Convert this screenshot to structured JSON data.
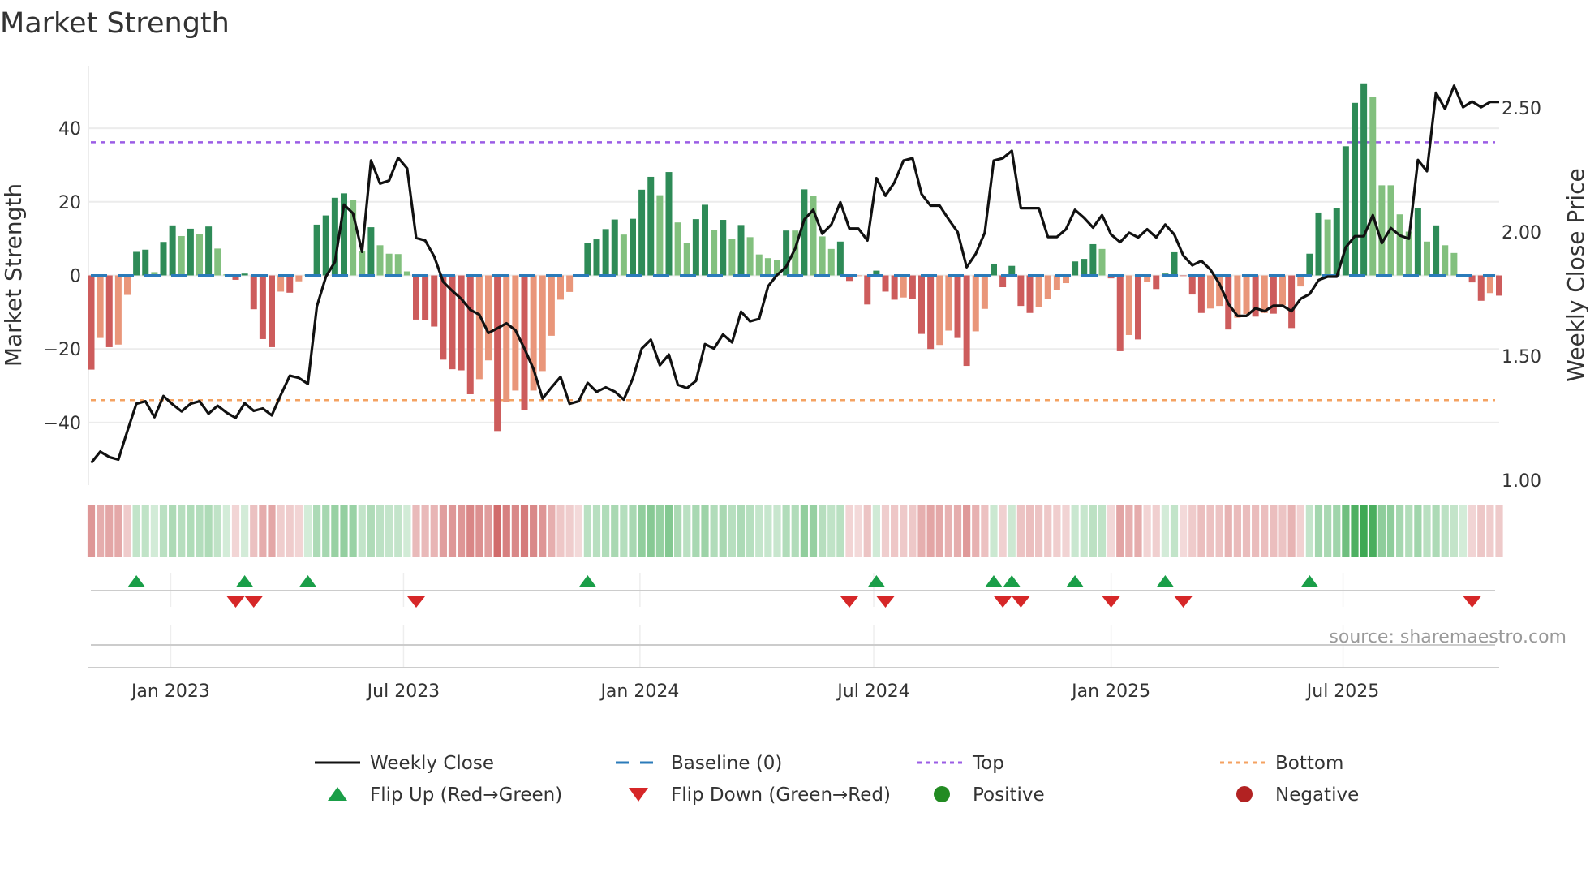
{
  "chart_data": {
    "type": "bar",
    "title": "Market Strength",
    "ylabel": "Market Strength",
    "y2label": "Weekly Close Price",
    "ylim": [
      -57,
      57
    ],
    "y2lim": [
      0.98,
      2.67
    ],
    "yticks": [
      -40,
      -20,
      0,
      20,
      40
    ],
    "yticklabels": [
      "−40",
      "−20",
      "0",
      "20",
      "40"
    ],
    "y2ticks": [
      1.0,
      1.5,
      2.0,
      2.5
    ],
    "y2ticklabels": [
      "1.00",
      "1.50",
      "2.00",
      "2.50"
    ],
    "x_unit": "week index",
    "xticks": [
      {
        "label": "Jan 2023",
        "week": 8.8
      },
      {
        "label": "Jul 2023",
        "week": 34.6
      },
      {
        "label": "Jan 2024",
        "week": 60.8
      },
      {
        "label": "Jul 2024",
        "week": 86.7
      },
      {
        "label": "Jan 2025",
        "week": 113.0
      },
      {
        "label": "Jul 2025",
        "week": 138.7
      }
    ],
    "grid": true,
    "reference_lines": {
      "baseline": 0,
      "top": 36.2,
      "bottom": -33.9
    },
    "series": [
      {
        "name": "Market Strength",
        "type": "bar",
        "values": [
          -25.6,
          -17,
          -19.5,
          -18.8,
          -5.3,
          6.4,
          7,
          0.9,
          9.1,
          13.6,
          10.7,
          12.7,
          11.3,
          13.3,
          7.3,
          0.3,
          -1.2,
          0.5,
          -9.2,
          -17.3,
          -19.5,
          -4.4,
          -4.7,
          -1.6,
          0.2,
          13.8,
          16.3,
          21.1,
          22.3,
          20.6,
          6.5,
          13.1,
          8.2,
          5.9,
          5.8,
          1.1,
          -12,
          -12.2,
          -13.9,
          -22.9,
          -25.5,
          -25.8,
          -32.3,
          -28.2,
          -23.1,
          -42.3,
          -34.4,
          -31.3,
          -36.6,
          -31.3,
          -26,
          -16.4,
          -6.6,
          -4.5,
          -0.1,
          8.9,
          9.8,
          12.6,
          15.2,
          11.1,
          15.4,
          23.3,
          26.8,
          21.8,
          28.1,
          14.4,
          8.9,
          15.3,
          19.2,
          12.3,
          15.1,
          10,
          13.7,
          10.4,
          5.7,
          4.7,
          4.3,
          12.2,
          12.2,
          23.4,
          21.6,
          10.6,
          7.2,
          9.2,
          -1.5,
          -0.1,
          -7.9,
          1.3,
          -4.4,
          -6.6,
          -6,
          -6.4,
          -15.9,
          -20,
          -18.9,
          -15,
          -17,
          -24.6,
          -15.2,
          -9.1,
          3.2,
          -3.2,
          2.6,
          -8.3,
          -10.2,
          -8.6,
          -6.4,
          -3.9,
          -2.1,
          3.8,
          4.5,
          8.5,
          7.2,
          -0.8,
          -20.6,
          -16.2,
          -17.4,
          -1.7,
          -3.7,
          0.5,
          6.3,
          -0.1,
          -5.2,
          -10.2,
          -9,
          -8.3,
          -14.7,
          -11.5,
          -10.5,
          -11.2,
          -10.2,
          -10.4,
          -8.1,
          -14.3,
          -3,
          5.9,
          17.1,
          15.2,
          18.2,
          35.1,
          46.9,
          52.2,
          48.6,
          24.5,
          24.5,
          16.6,
          11.9,
          18.2,
          9.2,
          13.6,
          8.2,
          6.1,
          0.3,
          -1.9,
          -6.9,
          -4.8,
          -5.5
        ]
      },
      {
        "name": "Weekly Close",
        "type": "line",
        "axis": "right",
        "values": [
          1.07,
          1.115,
          1.093,
          1.083,
          1.198,
          1.308,
          1.318,
          1.254,
          1.339,
          1.306,
          1.277,
          1.308,
          1.318,
          1.268,
          1.3,
          1.272,
          1.251,
          1.31,
          1.279,
          1.289,
          1.261,
          1.343,
          1.421,
          1.412,
          1.388,
          1.7,
          1.82,
          1.88,
          2.11,
          2.075,
          1.92,
          2.288,
          2.195,
          2.207,
          2.299,
          2.256,
          1.976,
          1.966,
          1.901,
          1.799,
          1.763,
          1.731,
          1.686,
          1.667,
          1.593,
          1.612,
          1.632,
          1.604,
          1.53,
          1.448,
          1.329,
          1.374,
          1.416,
          1.308,
          1.318,
          1.392,
          1.356,
          1.374,
          1.357,
          1.325,
          1.409,
          1.53,
          1.566,
          1.463,
          1.506,
          1.384,
          1.371,
          1.4,
          1.548,
          1.53,
          1.587,
          1.555,
          1.679,
          1.64,
          1.65,
          1.782,
          1.827,
          1.86,
          1.934,
          2.05,
          2.089,
          1.993,
          2.03,
          2.12,
          2.014,
          2.014,
          1.966,
          2.217,
          2.146,
          2.2,
          2.288,
          2.297,
          2.153,
          2.106,
          2.106,
          2.051,
          2.0,
          1.858,
          1.912,
          1.997,
          2.288,
          2.297,
          2.327,
          2.096,
          2.096,
          2.096,
          1.98,
          1.98,
          2.011,
          2.089,
          2.057,
          2.018,
          2.068,
          1.99,
          1.959,
          1.997,
          1.978,
          2.011,
          1.978,
          2.03,
          1.99,
          1.905,
          1.866,
          1.884,
          1.849,
          1.792,
          1.71,
          1.662,
          1.662,
          1.693,
          1.681,
          1.703,
          1.703,
          1.681,
          1.731,
          1.75,
          1.806,
          1.82,
          1.82,
          1.938,
          1.983,
          1.983,
          2.068,
          1.955,
          2.016,
          1.986,
          1.973,
          2.29,
          2.245,
          2.561,
          2.496,
          2.589,
          2.503,
          2.526,
          2.503,
          2.524,
          2.524
        ]
      }
    ],
    "flip_up_weeks": [
      5,
      17,
      24,
      55,
      87,
      100,
      102,
      109,
      119,
      135
    ],
    "flip_down_weeks": [
      16,
      18,
      36,
      84,
      88,
      101,
      103,
      113,
      121,
      153
    ],
    "legend": {
      "placement": "bottom",
      "entries": [
        {
          "label": "Weekly Close",
          "kind": "line-solid",
          "color": "#111111"
        },
        {
          "label": "Baseline (0)",
          "kind": "line-dashed",
          "color": "#2b7bba"
        },
        {
          "label": "Top",
          "kind": "line-dotted",
          "color": "#9b5de5"
        },
        {
          "label": "Bottom",
          "kind": "line-dotted",
          "color": "#f4a261"
        },
        {
          "label": "Flip Up (Red→Green)",
          "kind": "triangle-up",
          "color": "#1a9e48"
        },
        {
          "label": "Flip Down (Green→Red)",
          "kind": "triangle-down",
          "color": "#d62728"
        },
        {
          "label": "Positive",
          "kind": "circle",
          "color": "#228b22"
        },
        {
          "label": "Negative",
          "kind": "circle",
          "color": "#b22222"
        }
      ]
    },
    "source": "source: sharemaestro.com",
    "colors": {
      "pos_rising": "#2e8b57",
      "pos_falling": "#82c07e",
      "neg_falling": "#cd5c5c",
      "neg_rising": "#e9967a",
      "grid": "#ececec",
      "axis": "#cccccc"
    }
  }
}
